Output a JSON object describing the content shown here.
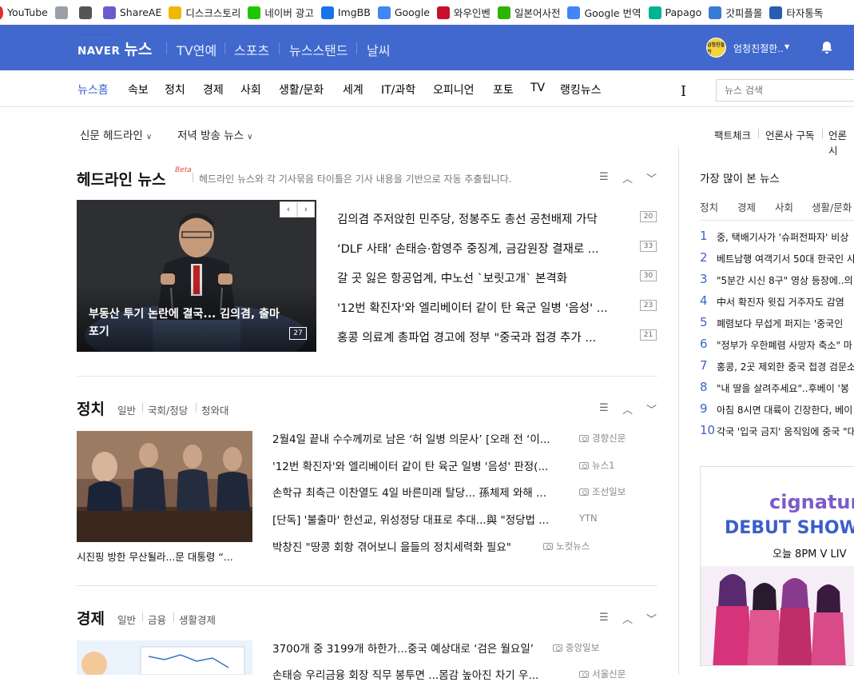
{
  "bookmarks": [
    {
      "label": "YouTube",
      "icon": "youtube-icon",
      "color": "#e52d27"
    },
    {
      "label": "",
      "icon": "gray-square-icon",
      "color": "#9aa0a6"
    },
    {
      "label": "",
      "icon": "camera-icon",
      "color": "#555"
    },
    {
      "label": "ShareAE",
      "icon": "shareae-icon",
      "color": "#6a5acd"
    },
    {
      "label": "디스크스토리",
      "icon": "disk-icon",
      "color": "#f2b705"
    },
    {
      "label": "네이버 광고",
      "icon": "naver-n-icon",
      "color": "#1ec800"
    },
    {
      "label": "ImgBB",
      "icon": "imgbb-icon",
      "color": "#1a73e8"
    },
    {
      "label": "Google",
      "icon": "google-icon",
      "color": "#4285f4"
    },
    {
      "label": "와우인벤",
      "icon": "inven-icon",
      "color": "#c8102e"
    },
    {
      "label": "일본어사전",
      "icon": "dict-icon",
      "color": "#2db400"
    },
    {
      "label": "Google 번역",
      "icon": "translate-icon",
      "color": "#4285f4"
    },
    {
      "label": "Papago",
      "icon": "papago-icon",
      "color": "#00b493"
    },
    {
      "label": "갓피플몰",
      "icon": "godpeople-icon",
      "color": "#3a7bd5"
    },
    {
      "label": "타자통독",
      "icon": "typing-icon",
      "color": "#2a5db0"
    }
  ],
  "header": {
    "naver": "NAVER",
    "news": "뉴스",
    "nav": [
      "TV연예",
      "스포츠",
      "뉴스스탠드",
      "날씨"
    ],
    "user_name": "엄청친절한..",
    "avatar_text": "엄청친절한"
  },
  "subnav": {
    "items": [
      "뉴스홈",
      "속보",
      "정치",
      "경제",
      "사회",
      "생활/문화",
      "세계",
      "IT/과학",
      "오피니언",
      "포토",
      "TV",
      "랭킹뉴스"
    ],
    "search_placeholder": "뉴스 검색"
  },
  "row3": {
    "left": [
      "신문 헤드라인",
      "저녁 방송 뉴스"
    ],
    "right": [
      "팩트체크",
      "언론사 구독",
      "언론시"
    ]
  },
  "headline_section": {
    "title": "헤드라인 뉴스",
    "beta": "Beta",
    "desc": "헤드라인 뉴스와 각 기사묶음 타이틀은 기사 내용을 기반으로 자동 추출됩니다.",
    "photo_caption": "부동산 투기 논란에 결국... 김의겸, 출마 포기",
    "photo_count": "27",
    "items": [
      {
        "text": "김의겸 주저앉힌 민주당, 정봉주도 총선 공천배제 가닥",
        "count": "20"
      },
      {
        "text": "‘DLF 사태’ 손태승·함영주 중징계, 금감원장 결재로 ...",
        "count": "33"
      },
      {
        "text": "갈 곳 잃은 항공업계, 中노선 `보릿고개` 본격화",
        "count": "30"
      },
      {
        "text": "'12번 확진자'와 엘리베이터 같이 탄 육군 일병 '음성' ...",
        "count": "23"
      },
      {
        "text": "홍콩 의료계 총파업 경고에 정부 \"중국과 접경 추가 ...",
        "count": "21"
      }
    ]
  },
  "politics": {
    "title": "정치",
    "subs": [
      "일반",
      "국회/정당",
      "청와대"
    ],
    "photo_caption": "시진핑 방한 무산될라...문 대통령 “...",
    "items": [
      {
        "text": "2월4일 끝내 수수께끼로 남은 ‘허 일병 의문사’ [오래 전 ‘이...",
        "source": "경향신문",
        "cam": true
      },
      {
        "text": "'12번 확진자'와 엘리베이터 같이 탄 육군 일병 '음성' 판정(...",
        "source": "뉴스1",
        "cam": true
      },
      {
        "text": "손학규 최측근 이찬열도 4일 바른미래 탈당... 孫체제 와해 ...",
        "source": "조선일보",
        "cam": true
      },
      {
        "text": "[단독] '불출마' 한선교, 위성정당 대표로 추대...與 \"정당법 ...",
        "source": "YTN",
        "cam": false
      },
      {
        "text": "박창진 \"땅콩 회항 겪어보니 을들의 정치세력화 필요\"",
        "source": "노컷뉴스",
        "cam": true
      }
    ]
  },
  "economy": {
    "title": "경제",
    "subs": [
      "일반",
      "금융",
      "생활경제"
    ],
    "items": [
      {
        "text": "3700개 중 3199개 하한가...중국 예상대로 ‘검은 월요일’",
        "source": "중앙일보",
        "cam": true
      },
      {
        "text": "손태승 우리금융 회장 직무 봉투면 ...몸감 높아진 차기 우...",
        "source": "서울신문",
        "cam": true
      }
    ]
  },
  "ranking": {
    "title": "가장 많이 본 뉴스",
    "tabs": [
      "정치",
      "경제",
      "사회",
      "생활/문화"
    ],
    "items": [
      "중, 택배기사가 '슈퍼전파자' 비상",
      "베트남행 여객기서 50대 한국인 사",
      "\"5분간 시신 8구\" 영상 등장에..의",
      "中서 확진자 윗집 거주자도 감염",
      "폐렴보다 무섭게 퍼지는 '중국인",
      "\"정부가 우한폐렴 사망자 축소\" 마",
      "홍콩, 2곳 제외한 중국 접경 검문소",
      "\"내 딸을 살려주세요\"..후베이 '봉",
      "아침 8시면 대륙이 긴장한다, 베이",
      "각국 '입국 금지' 움직임에 중국 \"대"
    ]
  },
  "ad": {
    "brand": "cignatur",
    "headline": "DEBUT SHOW",
    "time": "오늘 8PM V LIV"
  }
}
